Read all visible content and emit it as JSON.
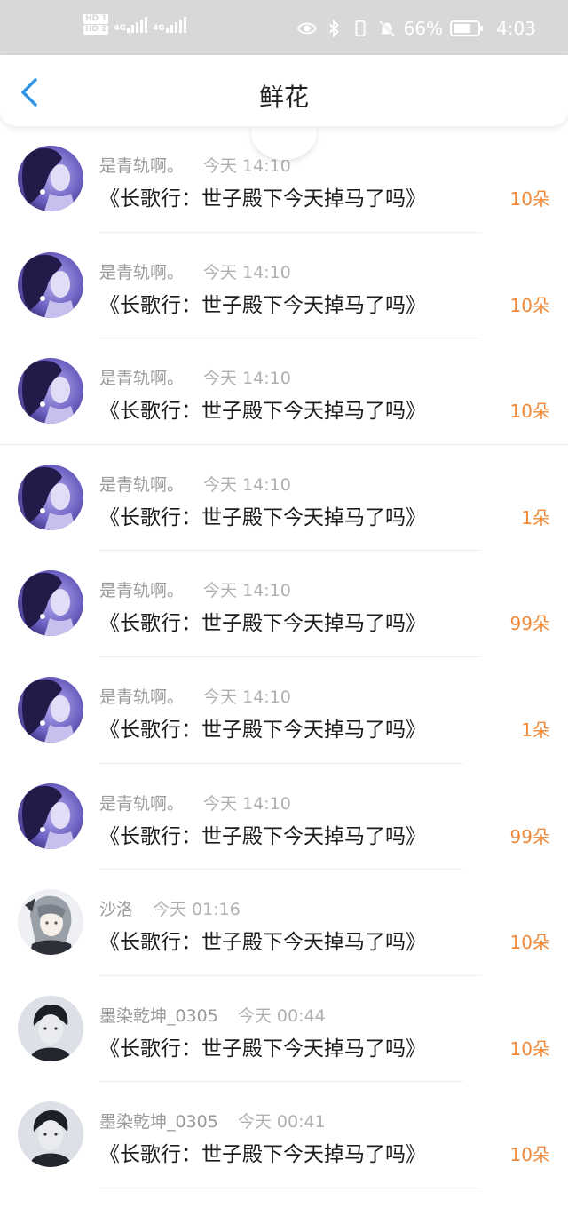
{
  "status_bar": {
    "hd1": "HD 1",
    "hd2": "HD 2",
    "net1": "4G",
    "net2": "4G",
    "battery_percent": "66%",
    "time": "4:03",
    "icons": [
      "eye-icon",
      "bluetooth-icon",
      "mute-bell-icon",
      "battery-icon"
    ]
  },
  "header": {
    "title": "鲜花",
    "back_icon": "chevron-left-icon",
    "accent_color": "#2f95e8"
  },
  "items": [
    {
      "user": "是青轨啊。",
      "time": "今天 14:10",
      "book": "《长歌行：世子殿下今天掉马了吗》",
      "count": "10朵",
      "avatar": "purple-girl"
    },
    {
      "user": "是青轨啊。",
      "time": "今天 14:10",
      "book": "《长歌行：世子殿下今天掉马了吗》",
      "count": "10朵",
      "avatar": "purple-girl"
    },
    {
      "user": "是青轨啊。",
      "time": "今天 14:10",
      "book": "《长歌行：世子殿下今天掉马了吗》",
      "count": "10朵",
      "avatar": "purple-girl"
    },
    {
      "user": "是青轨啊。",
      "time": "今天 14:10",
      "book": "《长歌行：世子殿下今天掉马了吗》",
      "count": "1朵",
      "avatar": "purple-girl"
    },
    {
      "user": "是青轨啊。",
      "time": "今天 14:10",
      "book": "《长歌行：世子殿下今天掉马了吗》",
      "count": "99朵",
      "avatar": "purple-girl"
    },
    {
      "user": "是青轨啊。",
      "time": "今天 14:10",
      "book": "《长歌行：世子殿下今天掉马了吗》",
      "count": "1朵",
      "avatar": "purple-girl"
    },
    {
      "user": "是青轨啊。",
      "time": "今天 14:10",
      "book": "《长歌行：世子殿下今天掉马了吗》",
      "count": "99朵",
      "avatar": "purple-girl"
    },
    {
      "user": "沙洛",
      "time": "今天 01:16",
      "book": "《长歌行：世子殿下今天掉马了吗》",
      "count": "10朵",
      "avatar": "anime-silver"
    },
    {
      "user": "墨染乾坤_0305",
      "time": "今天 00:44",
      "book": "《长歌行：世子殿下今天掉马了吗》",
      "count": "10朵",
      "avatar": "mono-boy"
    },
    {
      "user": "墨染乾坤_0305",
      "time": "今天 00:41",
      "book": "《长歌行：世子殿下今天掉马了吗》",
      "count": "10朵",
      "avatar": "mono-boy"
    }
  ],
  "colors": {
    "count": "#f08a3a",
    "username": "#9a9a9a",
    "status_bar_bg": "#d8d8d8"
  }
}
